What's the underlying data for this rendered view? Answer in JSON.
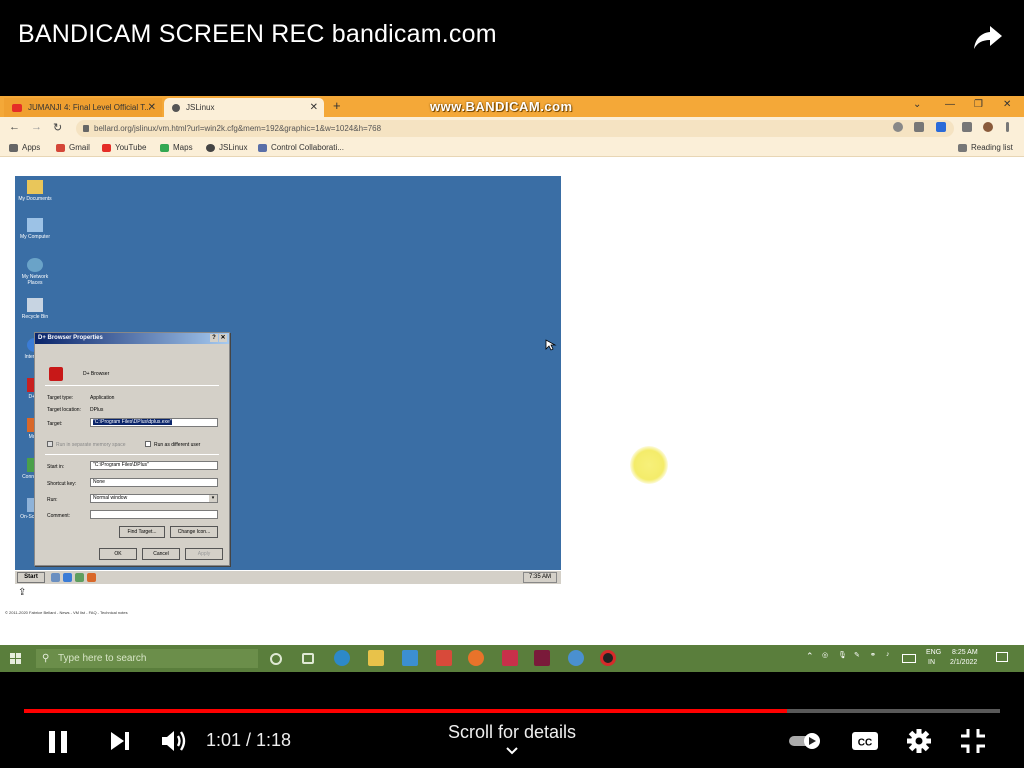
{
  "video": {
    "title": "BANDICAM SCREEN REC bandicam.com",
    "current_time": "1:01",
    "duration": "1:18",
    "time_display": "1:01 / 1:18",
    "progress": 0.782,
    "scroll_hint": "Scroll for details"
  },
  "browser": {
    "tabs": [
      {
        "label": "JUMANJI 4: Final Level Official T...",
        "icon": "youtube-icon"
      },
      {
        "label": "JSLinux",
        "icon": "globe-icon"
      }
    ],
    "watermark": "www.BANDICAM.com",
    "url": "bellard.org/jslinux/vm.html?url=win2k.cfg&mem=192&graphic=1&w=1024&h=768",
    "bookmarks": [
      "Apps",
      "Gmail",
      "YouTube",
      "Maps",
      "JSLinux",
      "Control Collaborati..."
    ],
    "reading_list": "Reading list"
  },
  "vm": {
    "desktop_icons": [
      "My Documents",
      "My Computer",
      "My Network Places",
      "Recycle Bin",
      "Inter Expl",
      "D+ Br",
      "Mozill",
      "Conn the In",
      "On-Sc Keybo"
    ],
    "start_label": "Start",
    "clock": "7:35 AM",
    "footer": "© 2011-2020 Fabrice Bellard - News - VM list - FAQ - Technical notes"
  },
  "dialog": {
    "title": "D+ Browser Properties",
    "app_name": "D+ Browser",
    "target_type_label": "Target type:",
    "target_type_value": "Application",
    "target_location_label": "Target location:",
    "target_location_value": "DPlus",
    "target_label": "Target:",
    "target_value": "\"C:\\Program Files\\DPlus\\dplus.exe\"",
    "separate_memory_label": "Run in separate memory space",
    "run_as_label": "Run as different user",
    "start_in_label": "Start in:",
    "start_in_value": "\"C:\\Program Files\\DPlus\"",
    "shortcut_key_label": "Shortcut key:",
    "shortcut_key_value": "None",
    "run_label": "Run:",
    "run_value": "Normal window",
    "comment_label": "Comment:",
    "find_target": "Find Target...",
    "change_icon": "Change Icon...",
    "ok": "OK",
    "cancel": "Cancel",
    "apply": "Apply"
  },
  "host_taskbar": {
    "search_placeholder": "Type here to search",
    "lang": "ENG",
    "region": "IN",
    "time": "8:25 AM",
    "date": "2/1/2022"
  },
  "colors": {
    "progress": "#ff0000",
    "tab_strip": "#f4a838",
    "desktop": "#3a6ea5",
    "win_taskbar": "#5a7e3c"
  }
}
